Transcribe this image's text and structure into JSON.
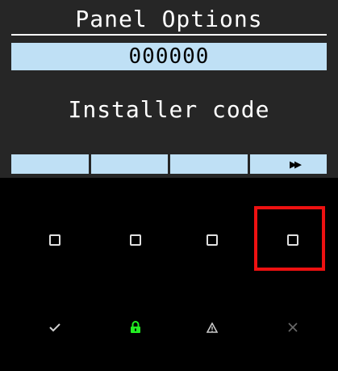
{
  "screen": {
    "title": "Panel Options",
    "code_value": "000000",
    "prompt": "Installer code",
    "softkeys": [
      {
        "label": ""
      },
      {
        "label": ""
      },
      {
        "label": ""
      },
      {
        "label": "▶▶",
        "icon": "fast-forward-icon"
      }
    ]
  },
  "keypad": {
    "function_keys": [
      {
        "icon": "square-icon"
      },
      {
        "icon": "square-icon"
      },
      {
        "icon": "square-icon"
      },
      {
        "icon": "square-icon",
        "highlighted": true
      }
    ],
    "bottom_keys": [
      {
        "icon": "check-icon",
        "color": "#d0d0d0"
      },
      {
        "icon": "lock-icon",
        "color": "#22ee22"
      },
      {
        "icon": "warning-icon",
        "color": "#c8c8c8"
      },
      {
        "icon": "close-icon",
        "color": "#6a6a6a"
      }
    ]
  },
  "colors": {
    "screen_background": "#262626",
    "field_background": "#bfe0f5",
    "highlight": "#ee1111"
  }
}
